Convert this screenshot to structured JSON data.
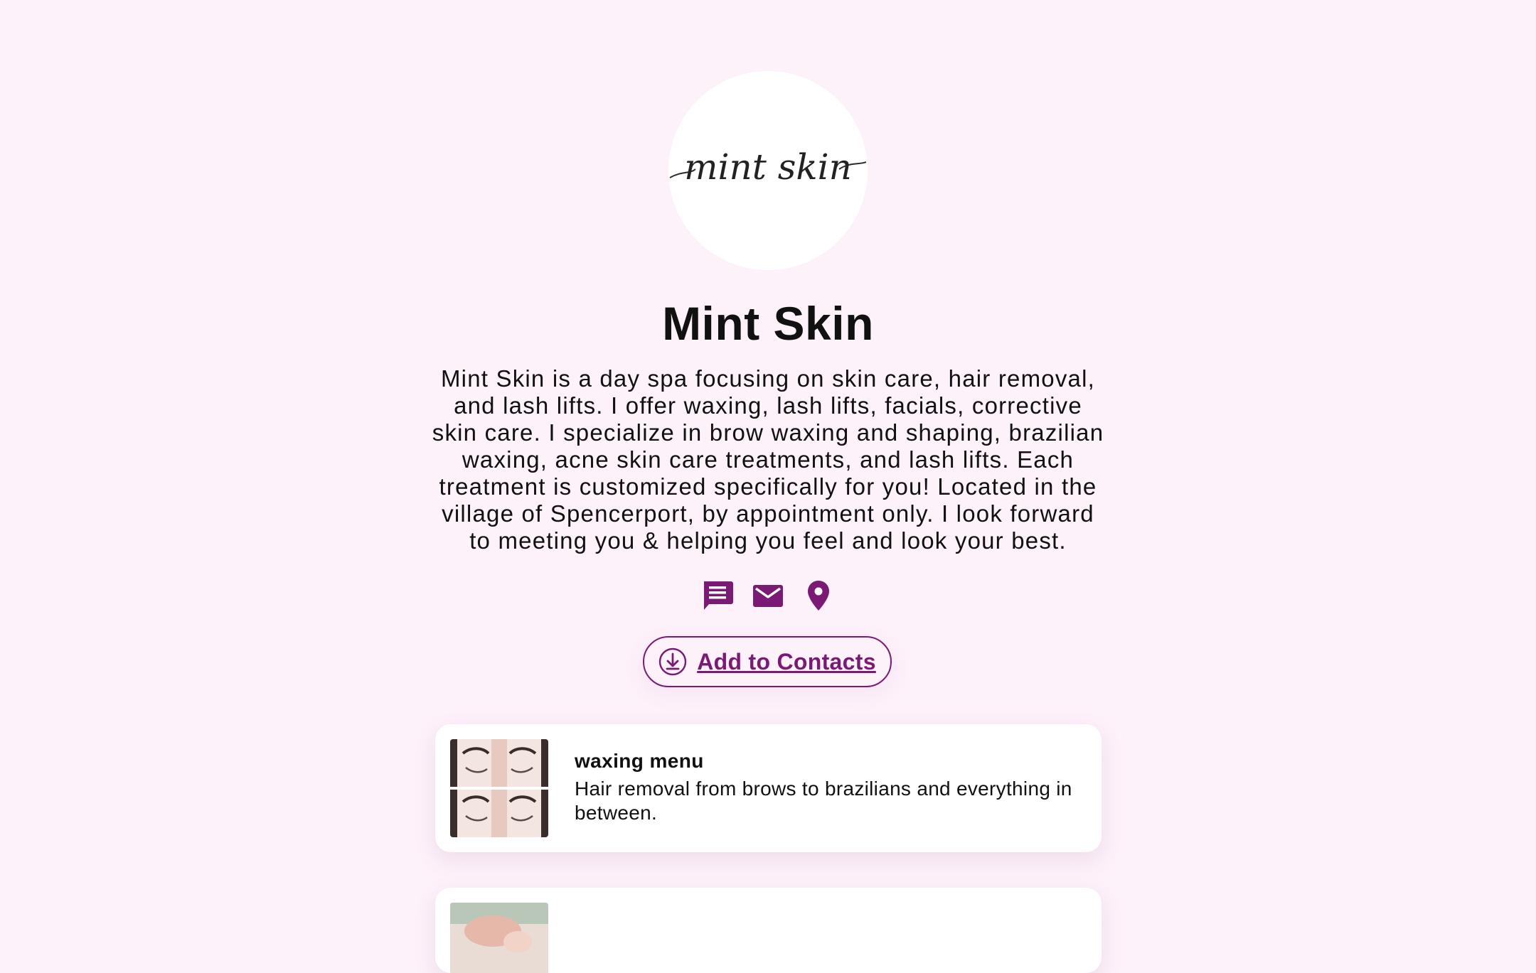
{
  "profile": {
    "logo_text": "mint skin",
    "name": "Mint Skin",
    "bio": "Mint Skin is a day spa focusing on skin care, hair removal, and lash lifts. I offer waxing, lash lifts, facials, corrective skin care. I specialize in brow waxing and shaping, brazilian waxing, acne skin care treatments, and lash lifts. Each treatment is customized specifically for you! Located in the village of Spencerport, by appointment only. I look forward to meeting you & helping you feel and look your best."
  },
  "socials": [
    {
      "icon": "message-icon"
    },
    {
      "icon": "email-icon"
    },
    {
      "icon": "location-pin-icon"
    }
  ],
  "contacts_button": {
    "label": "Add to Contacts",
    "icon": "download-circle-icon"
  },
  "links": [
    {
      "title": "waxing menu",
      "description": "Hair removal from brows to brazilians and everything in between."
    },
    {
      "title": "",
      "description": ""
    }
  ],
  "colors": {
    "background": "#fdf1fa",
    "accent": "#7a1a75",
    "card": "#ffffff",
    "text": "#111111"
  }
}
